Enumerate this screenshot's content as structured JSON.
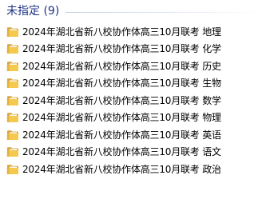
{
  "group": {
    "title": "未指定 (9)"
  },
  "files": [
    {
      "name": "2024年湖北省新八校协作体高三10月联考 地理",
      "icon": "folder-icon"
    },
    {
      "name": "2024年湖北省新八校协作体高三10月联考 化学",
      "icon": "folder-icon"
    },
    {
      "name": "2024年湖北省新八校协作体高三10月联考 历史",
      "icon": "folder-icon"
    },
    {
      "name": "2024年湖北省新八校协作体高三10月联考 生物",
      "icon": "folder-icon"
    },
    {
      "name": "2024年湖北省新八校协作体高三10月联考 数学",
      "icon": "folder-icon"
    },
    {
      "name": "2024年湖北省新八校协作体高三10月联考 物理",
      "icon": "folder-icon"
    },
    {
      "name": "2024年湖北省新八校协作体高三10月联考 英语",
      "icon": "folder-icon"
    },
    {
      "name": "2024年湖北省新八校协作体高三10月联考 语文",
      "icon": "folder-icon"
    },
    {
      "name": "2024年湖北省新八校协作体高三10月联考 政治",
      "icon": "folder-icon"
    }
  ],
  "colors": {
    "group_title": "#1e3287",
    "folder_back": "#d9a53a",
    "folder_front": "#f5c94e"
  }
}
